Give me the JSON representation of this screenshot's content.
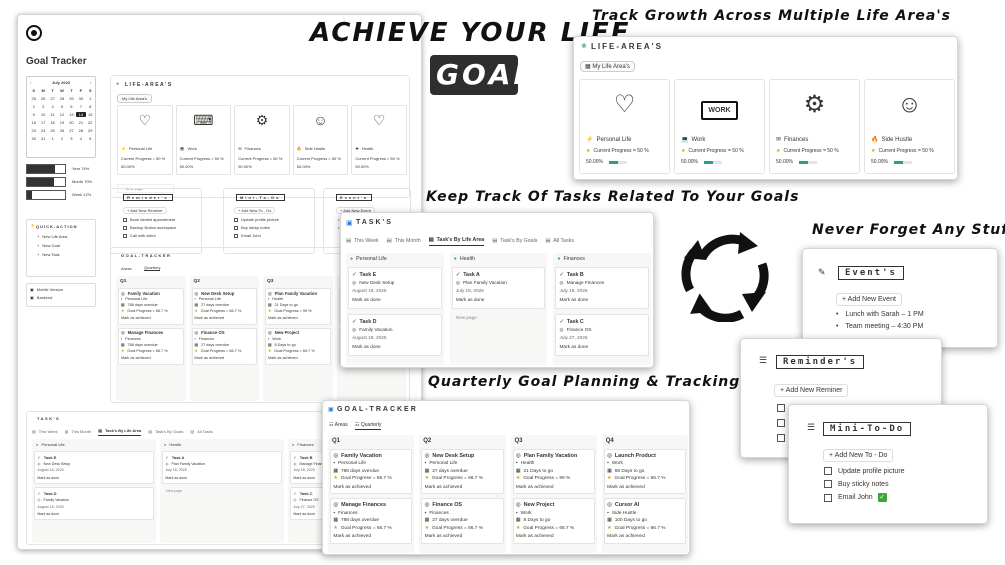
{
  "headline": {
    "line1": "ACHIEVE YOUR LIFE",
    "line2": "GOALS"
  },
  "captions": {
    "life_areas": "Track Growth Across Multiple Life Area's",
    "tasks": "Keep Track Of Tasks Related To Your Goals",
    "quarterly": "Quarterly Goal Planning & Tracking",
    "never_forget": "Never Forget Any Stuff"
  },
  "dashboard": {
    "title": "Goal Tracker",
    "calendar": {
      "month": "July 2023",
      "days": [
        "S",
        "M",
        "T",
        "W",
        "T",
        "F",
        "S"
      ],
      "dates": [
        "25",
        "26",
        "27",
        "28",
        "29",
        "30",
        "1",
        "2",
        "3",
        "4",
        "5",
        "6",
        "7",
        "8",
        "9",
        "10",
        "11",
        "12",
        "13",
        "14",
        "15",
        "16",
        "17",
        "18",
        "19",
        "20",
        "21",
        "22",
        "23",
        "24",
        "25",
        "26",
        "27",
        "28",
        "29",
        "30",
        "31",
        "1",
        "2",
        "3",
        "4",
        "5"
      ],
      "today": "14"
    },
    "progress": [
      {
        "label": "Year 74%",
        "value": 0.74
      },
      {
        "label": "Month 70%",
        "value": 0.7
      },
      {
        "label": "Week 12%",
        "value": 0.12
      }
    ],
    "quick_action": {
      "title": "QUICK-ACTION",
      "items": [
        "New Life Area",
        "New Goal",
        "New Task"
      ]
    },
    "other_links": [
      "Mobile Version",
      "Backend"
    ],
    "life_areas": {
      "title": "LIFE-AREA'S",
      "view": "My Life Area's",
      "new_page": "New page",
      "items": [
        {
          "name": "Personal Life",
          "progress": "Current Progress = 50 %",
          "pct": "50.00%"
        },
        {
          "name": "Work",
          "progress": "Current Progress = 50 %",
          "pct": "50.00%"
        },
        {
          "name": "Finances",
          "progress": "Current Progress = 50 %",
          "pct": "50.00%"
        },
        {
          "name": "Side Hustle",
          "progress": "Current Progress = 50 %",
          "pct": "50.00%"
        },
        {
          "name": "Health",
          "progress": "Current Progress = 50 %",
          "pct": "50.00%"
        }
      ]
    },
    "reminders": {
      "title": "Reminder's",
      "add": "Add New Reminer",
      "items": [
        "Book dentist appointment",
        "Backup Notion workspace",
        "Call with client"
      ]
    },
    "todo": {
      "title": "Mini-To-Do",
      "add": "Add New To - Do",
      "items": [
        "Update profile picture",
        "Buy sticky notes",
        "Email John"
      ]
    },
    "events": {
      "title": "Event's",
      "add": "Add New Event",
      "items": [
        "Lunch with Sarah",
        "Team meeting"
      ]
    }
  },
  "life_area_card": {
    "title": "LIFE-AREA'S",
    "view": "My Life Area's",
    "items": [
      {
        "name": "Personal Life",
        "icon_word": "",
        "progress": "Current Progress = 50 %",
        "pct": "50.00%"
      },
      {
        "name": "Work",
        "icon_word": "WORK",
        "progress": "Current Progress = 50 %",
        "pct": "50.00%"
      },
      {
        "name": "Finances",
        "icon_word": "",
        "progress": "Current Progress = 50 %",
        "pct": "50.00%"
      },
      {
        "name": "Side Hustle",
        "icon_word": "",
        "progress": "Current Progress = 50 %",
        "pct": "50.00%"
      }
    ]
  },
  "task_card": {
    "title": "TASK'S",
    "tabs": [
      "This Week",
      "This Month",
      "Task's By Life Area",
      "Task's By Goals",
      "All Tasks"
    ],
    "active_tab": "Task's By Life Area",
    "columns": [
      {
        "name": "Personal Life",
        "tasks": [
          {
            "name": "Task E",
            "goal": "New Desk Setup",
            "date": "August 18, 2025",
            "btn": "Mark as done"
          },
          {
            "name": "Task D",
            "goal": "Family Vacation",
            "date": "August 18, 2025",
            "btn": "Mark as done"
          }
        ]
      },
      {
        "name": "Health",
        "tasks": [
          {
            "name": "Task A",
            "goal": "Plan Family Vacation",
            "date": "July 18, 2025",
            "btn": "Mark as done"
          }
        ],
        "new_page": "New page"
      },
      {
        "name": "Finances",
        "tasks": [
          {
            "name": "Task B",
            "goal": "Manage Finances",
            "date": "July 18, 2025",
            "btn": "Mark as done"
          },
          {
            "name": "Task C",
            "goal": "Finance OS",
            "date": "July 27, 2025",
            "btn": "Mark as done"
          }
        ]
      }
    ]
  },
  "goal_card": {
    "title": "GOAL-TRACKER",
    "tabs": [
      "Areas",
      "Quarterly"
    ],
    "active_tab": "Quarterly",
    "quarters": [
      {
        "q": "Q1",
        "goals": [
          {
            "name": "Family Vacation",
            "area": "Personal Life",
            "days": "788 days overdue",
            "progress": "Goal Progress = 66.7 %",
            "btn": "Mark as achieved"
          },
          {
            "name": "Manage Finances",
            "area": "Finances",
            "days": "788 days overdue",
            "progress": "Goal Progress = 66.7 %",
            "btn": "Mark as achieved"
          }
        ]
      },
      {
        "q": "Q2",
        "goals": [
          {
            "name": "New Desk Setup",
            "area": "Personal Life",
            "days": "27 days overdue",
            "progress": "Goal Progress = 66.7 %",
            "btn": "Mark as achieved"
          },
          {
            "name": "Finance OS",
            "area": "Finances",
            "days": "27 days overdue",
            "progress": "Goal Progress = 66.7 %",
            "btn": "Mark as achieved"
          }
        ]
      },
      {
        "q": "Q3",
        "goals": [
          {
            "name": "Plan Family Vacation",
            "area": "Health",
            "days": "21 Days to go",
            "progress": "Goal Progress = 99 %",
            "btn": "Mark as achieved"
          },
          {
            "name": "New Project",
            "area": "Work",
            "days": "8 Days to go",
            "progress": "Goal Progress = 65.7 %",
            "btn": "Mark as achieved"
          }
        ]
      },
      {
        "q": "Q4",
        "goals": [
          {
            "name": "Launch Product",
            "area": "Work",
            "days": "88 Days to go",
            "progress": "Goal Progress = 66.7 %",
            "btn": "Mark as achieved"
          },
          {
            "name": "Cursor AI",
            "area": "Side Hustle",
            "days": "100 Days to go",
            "progress": "Goal Progress = 66.7 %",
            "btn": "Mark as achieved"
          }
        ]
      }
    ]
  },
  "events_card": {
    "title": "Event's",
    "add": "Add New Event",
    "items": [
      "Lunch with Sarah – 1 PM",
      "Team meeting – 4:30 PM"
    ]
  },
  "reminders_card": {
    "title": "Reminder's",
    "add": "Add New Reminer"
  },
  "todo_card": {
    "title": "Mini-To-Do",
    "add": "Add New To - Do",
    "items": [
      "Update profile picture",
      "Buy sticky notes",
      "Email John"
    ]
  },
  "colors": {
    "accent": "#111111",
    "card_bg": "#ffffff",
    "border": "#d6d6d6",
    "muted": "#8a8a86",
    "check": "#3aa835"
  }
}
